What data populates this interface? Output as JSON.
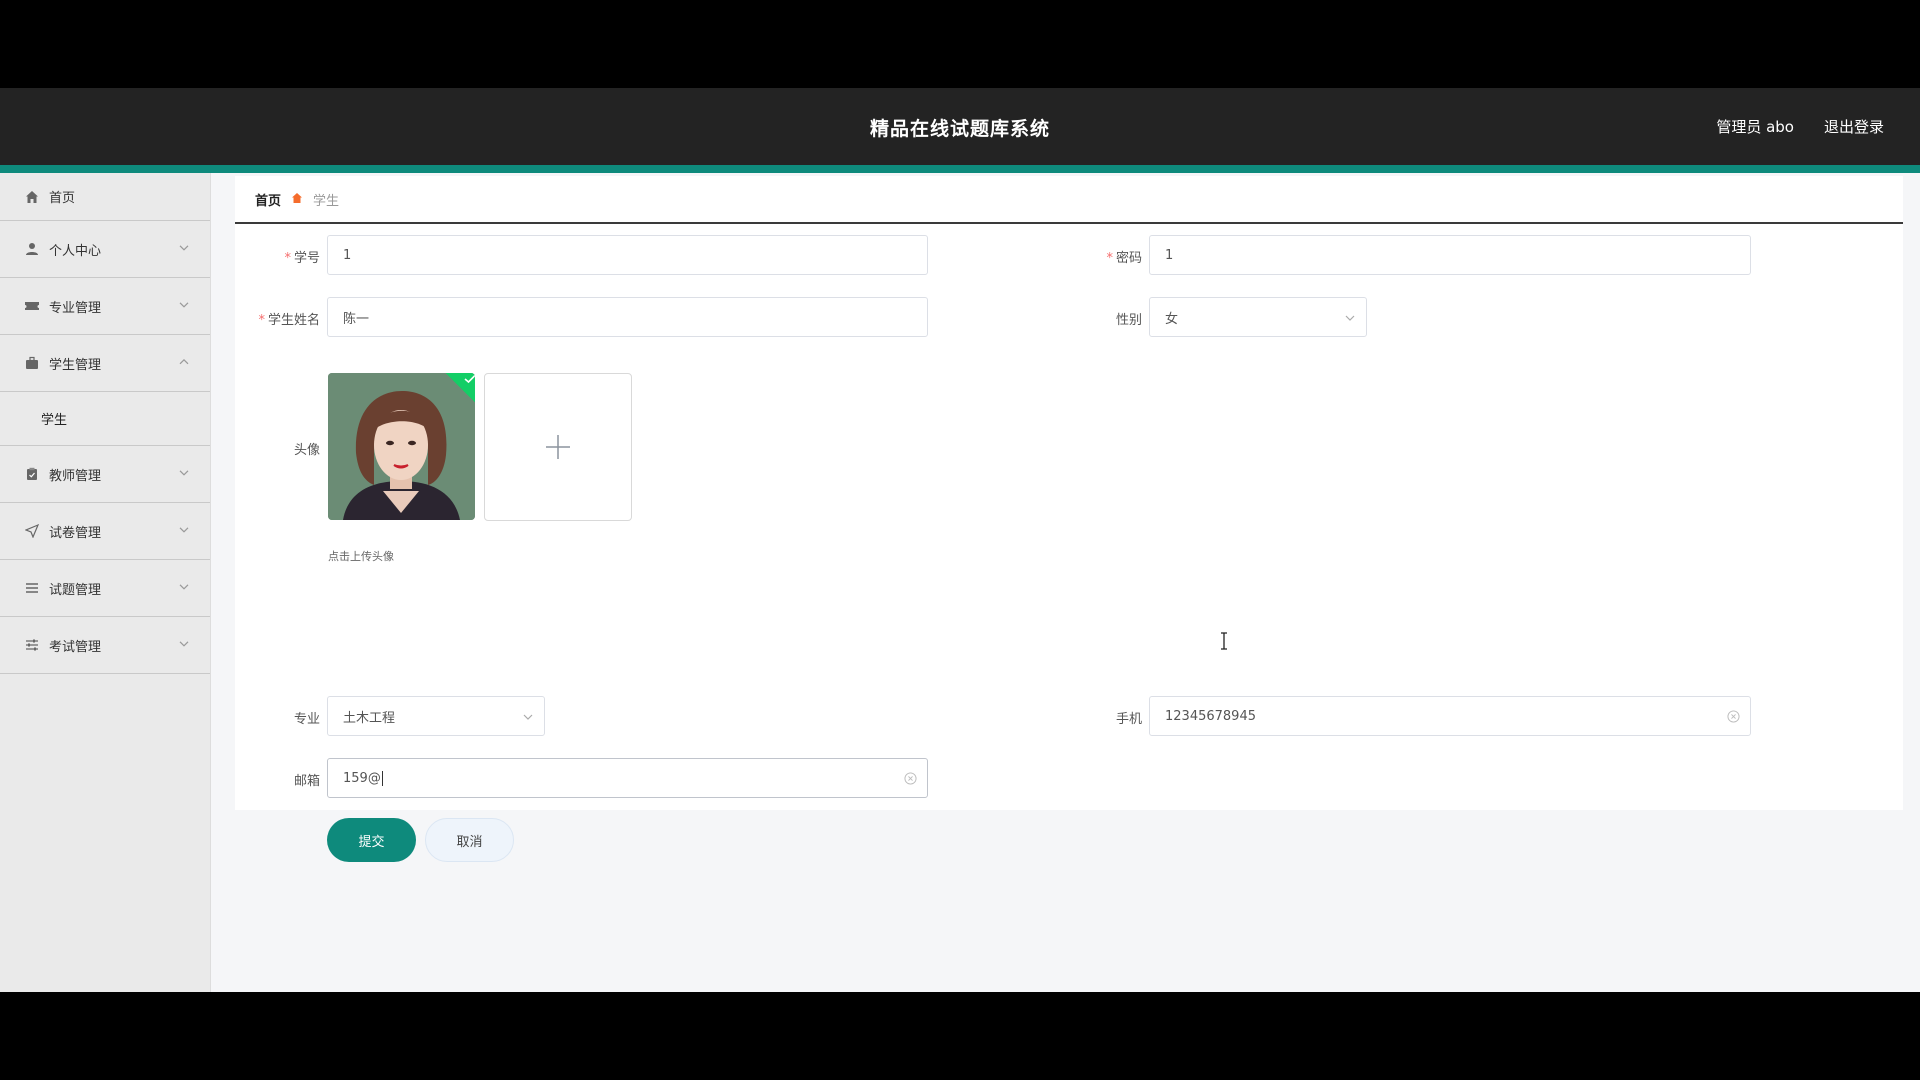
{
  "header": {
    "title": "精品在线试题库系统",
    "user": "管理员 abo",
    "logout": "退出登录",
    "accent_color": "#0e8a7c"
  },
  "sidebar": {
    "items": [
      {
        "label": "首页",
        "icon": "home-icon"
      },
      {
        "label": "个人中心",
        "icon": "user-icon"
      },
      {
        "label": "专业管理",
        "icon": "ticket-icon"
      },
      {
        "label": "学生管理",
        "icon": "briefcase-icon",
        "expanded": true,
        "children": [
          {
            "label": "学生"
          }
        ]
      },
      {
        "label": "教师管理",
        "icon": "clipboard-icon"
      },
      {
        "label": "试卷管理",
        "icon": "send-icon"
      },
      {
        "label": "试题管理",
        "icon": "list-icon"
      },
      {
        "label": "考试管理",
        "icon": "sliders-icon"
      }
    ]
  },
  "breadcrumb": {
    "home": "首页",
    "current": "学生"
  },
  "form": {
    "student_no": {
      "label": "学号",
      "value": "1",
      "required": true
    },
    "password": {
      "label": "密码",
      "value": "1",
      "required": true
    },
    "name": {
      "label": "学生姓名",
      "value": "陈一",
      "required": true
    },
    "gender": {
      "label": "性别",
      "value": "女"
    },
    "avatar": {
      "label": "头像",
      "hint": "点击上传头像"
    },
    "major": {
      "label": "专业",
      "value": "土木工程"
    },
    "phone": {
      "label": "手机",
      "value": "12345678945"
    },
    "email": {
      "label": "邮箱",
      "value": "159@"
    },
    "submit": "提交",
    "cancel": "取消"
  }
}
